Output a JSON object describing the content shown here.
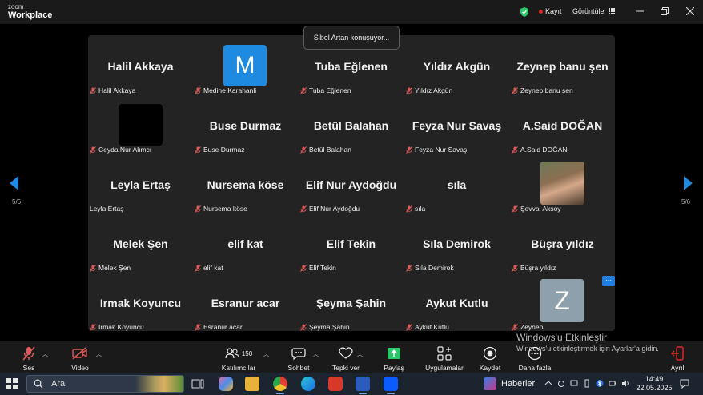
{
  "app": {
    "logo_line1": "zoom",
    "logo_line2": "Workplace",
    "record_label": "Kayıt",
    "view_label": "Görüntüle"
  },
  "speaking_toast": "Sibel Artan konuşuyor...",
  "pagination": {
    "left": "5/6",
    "right": "5/6"
  },
  "tiles": [
    {
      "display": "Halil Akkaya",
      "label": "Halil Akkaya",
      "muted": true
    },
    {
      "display": "",
      "avatar_letter": "M",
      "avatar_color": "#1e8ae0",
      "label": "Medine Karahanli",
      "muted": true
    },
    {
      "display": "Tuba Eğlenen",
      "label": "Tuba Eğlenen",
      "muted": true
    },
    {
      "display": "Yıldız Akgün",
      "label": "Yıldız Akgün",
      "muted": true
    },
    {
      "display": "Zeynep banu şen",
      "label": "Zeynep banu şen",
      "muted": true
    },
    {
      "display": "",
      "video": "black",
      "label": "Ceyda Nur Alımcı",
      "muted": true
    },
    {
      "display": "Buse Durmaz",
      "label": "Buse Durmaz",
      "muted": true
    },
    {
      "display": "Betül Balahan",
      "label": "Betül Balahan",
      "muted": true
    },
    {
      "display": "Feyza Nur Savaş",
      "label": "Feyza Nur Savaş",
      "muted": true
    },
    {
      "display": "A.Said DOĞAN",
      "label": "A.Said DOĞAN",
      "muted": true
    },
    {
      "display": "Leyla Ertaş",
      "label": "Leyla Ertaş",
      "muted": false
    },
    {
      "display": "Nursema köse",
      "label": "Nursema köse",
      "muted": true
    },
    {
      "display": "Elif Nur Aydoğdu",
      "label": "Elif Nur Aydoğdu",
      "muted": true
    },
    {
      "display": "sıla",
      "label": "sıla",
      "muted": true
    },
    {
      "display": "",
      "video": "photo",
      "label": "Şevval Aksoy",
      "muted": true
    },
    {
      "display": "Melek Şen",
      "label": "Melek Şen",
      "muted": true
    },
    {
      "display": "elif kat",
      "label": "elif kat",
      "muted": true
    },
    {
      "display": "Elif Tekin",
      "label": "Elif Tekin",
      "muted": true
    },
    {
      "display": "Sıla Demirok",
      "label": "Sıla Demirok",
      "muted": true
    },
    {
      "display": "Büşra yıldız",
      "label": "Büşra yıldız",
      "muted": true
    },
    {
      "display": "Irmak Koyuncu",
      "label": "Irmak Koyuncu",
      "muted": true
    },
    {
      "display": "Esranur acar",
      "label": "Esranur acar",
      "muted": true
    },
    {
      "display": "Şeyma Şahin",
      "label": "Şeyma Şahin",
      "muted": true
    },
    {
      "display": "Aykut Kutlu",
      "label": "Aykut Kutlu",
      "muted": true
    },
    {
      "display": "",
      "avatar_letter": "Z",
      "avatar_color": "#8da0ac",
      "label": "Zeynep",
      "muted": true
    }
  ],
  "more_button": "⋯",
  "toolbar": {
    "audio": "Ses",
    "video": "Video",
    "participants": "Katılımcılar",
    "participants_count": "150",
    "chat": "Sohbet",
    "react": "Tepki ver",
    "share": "Paylaş",
    "apps": "Uygulamalar",
    "record": "Kaydet",
    "more": "Daha fazla",
    "leave": "Ayrıl"
  },
  "watermark": {
    "line1": "Windows'u Etkinleştir",
    "line2": "Windows'u etkinleştirmek için Ayarlar'a gidin."
  },
  "taskbar": {
    "search_placeholder": "Ara",
    "news": "Haberler",
    "time": "14:49",
    "date": "22.05.2025"
  },
  "colors": {
    "accent": "#0b5cff",
    "share_green": "#2ac66a",
    "leave_red": "#e02828",
    "mute_red": "#e05a5a"
  }
}
